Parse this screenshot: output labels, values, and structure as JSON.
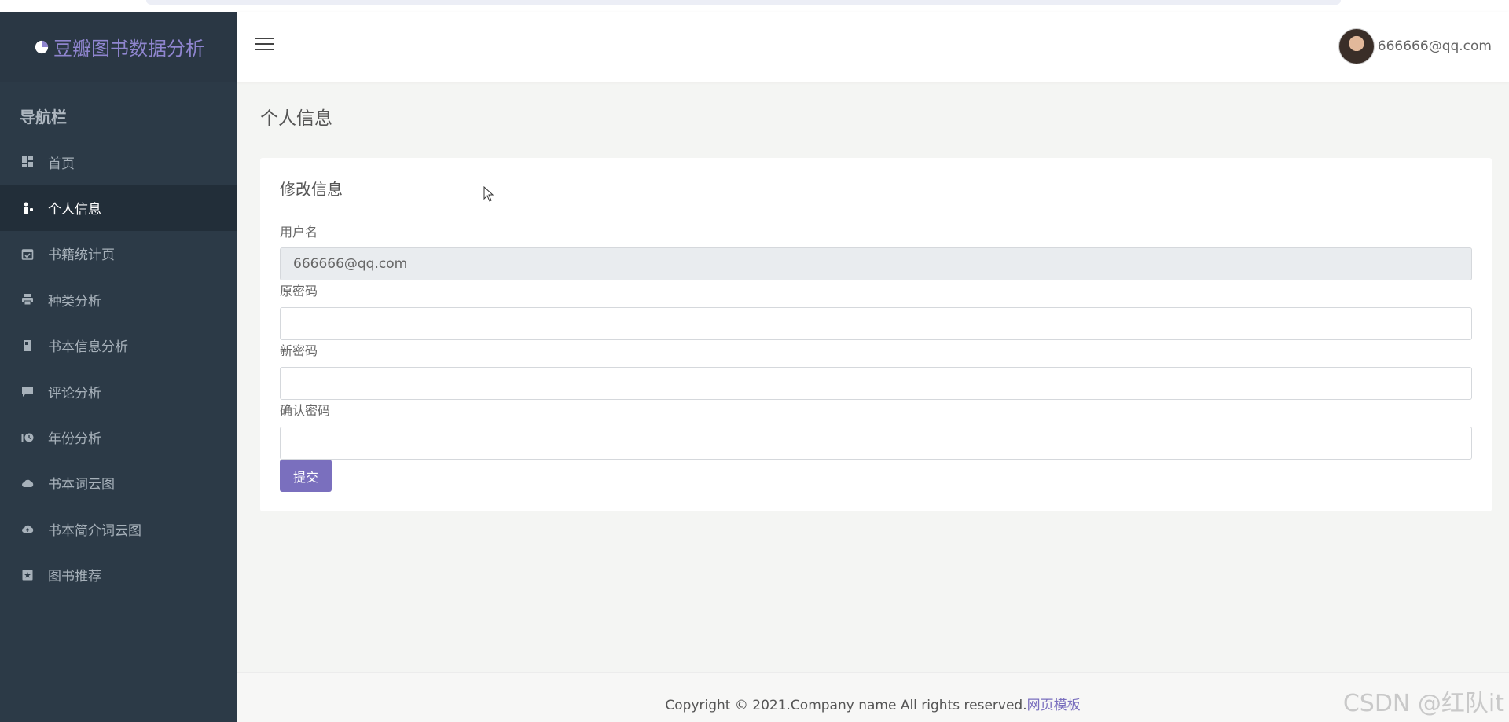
{
  "app": {
    "title": "豆瓣图书数据分析",
    "accent": "#7a6fbe",
    "sidebar_bg": "#2c3a47"
  },
  "sidebar": {
    "heading": "导航栏",
    "items": [
      {
        "label": "首页",
        "icon": "dashboard-icon",
        "active": false
      },
      {
        "label": "个人信息",
        "icon": "user-icon",
        "active": true
      },
      {
        "label": "书籍统计页",
        "icon": "calendar-check-icon",
        "active": false
      },
      {
        "label": "种类分析",
        "icon": "printer-icon",
        "active": false
      },
      {
        "label": "书本信息分析",
        "icon": "book-icon",
        "active": false
      },
      {
        "label": "评论分析",
        "icon": "comment-icon",
        "active": false
      },
      {
        "label": "年份分析",
        "icon": "history-icon",
        "active": false
      },
      {
        "label": "书本词云图",
        "icon": "cloud-icon",
        "active": false
      },
      {
        "label": "书本简介词云图",
        "icon": "cloud-upload-icon",
        "active": false
      },
      {
        "label": "图书推荐",
        "icon": "star-box-icon",
        "active": false
      }
    ]
  },
  "header": {
    "user_email": "666666@qq.com"
  },
  "page": {
    "title": "个人信息"
  },
  "form": {
    "title": "修改信息",
    "username_label": "用户名",
    "username_value": "666666@qq.com",
    "old_password_label": "原密码",
    "old_password_value": "",
    "new_password_label": "新密码",
    "new_password_value": "",
    "confirm_password_label": "确认密码",
    "confirm_password_value": "",
    "submit_label": "提交"
  },
  "footer": {
    "text": "Copyright © 2021.Company name All rights reserved.",
    "link": "网页模板"
  },
  "watermark": "CSDN @红队it"
}
